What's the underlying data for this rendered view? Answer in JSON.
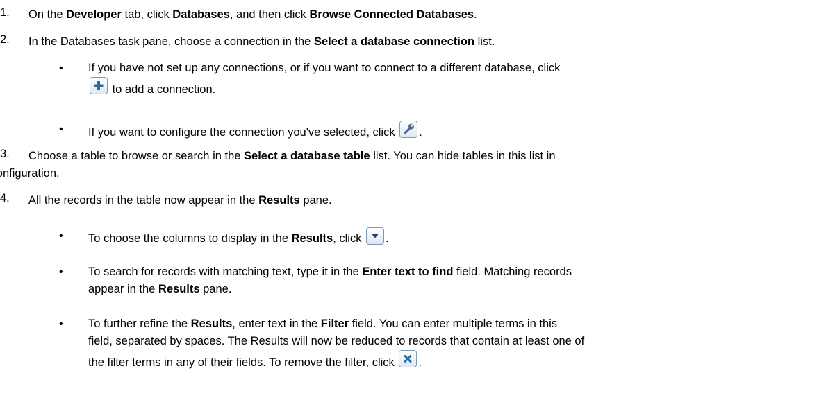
{
  "steps": [
    {
      "num": "1.",
      "parts": [
        "On the ",
        "Developer",
        " tab, click ",
        "Databases",
        ", and then click ",
        "Browse Connected Databases",
        "."
      ]
    },
    {
      "num": "2.",
      "parts": [
        "In the Databases task pane, choose a connection in the ",
        "Select a database connection",
        " list."
      ],
      "bullets": [
        {
          "parts": [
            "If you have not set up any connections, or if you want to connect to a different database, click",
            "to add a connection."
          ],
          "icon": "add-icon"
        },
        {
          "parts": [
            "If you want to configure the connection you've selected, click",
            "."
          ],
          "icon": "wrench-icon"
        }
      ]
    },
    {
      "num": "3.",
      "parts": [
        "Choose a table to browse or search in the ",
        "Select a database table",
        " list. You can hide tables in this list in",
        "the configuration."
      ]
    },
    {
      "num": "4.",
      "parts": [
        "All the records in the table now appear in the ",
        "Results",
        " pane."
      ],
      "bullets": [
        {
          "parts": [
            "To choose the columns to display in the ",
            "Results",
            ", click",
            "."
          ],
          "icon": "dropdown-arrow-icon"
        },
        {
          "parts": [
            "To search for records with matching text, type it in the ",
            "Enter text to find",
            " field. Matching records",
            "appear in the ",
            "Results",
            " pane."
          ]
        },
        {
          "parts": [
            "To further refine the ",
            "Results",
            ", enter text in the ",
            "Filter",
            " field. You can enter multiple terms in this",
            "field, separated by spaces. The Results will now be reduced to records that contain at least one of",
            "the filter terms in any of their fields. To remove the filter, click",
            "."
          ],
          "icon": "remove-filter-icon"
        }
      ]
    }
  ],
  "bullet_char": "•"
}
